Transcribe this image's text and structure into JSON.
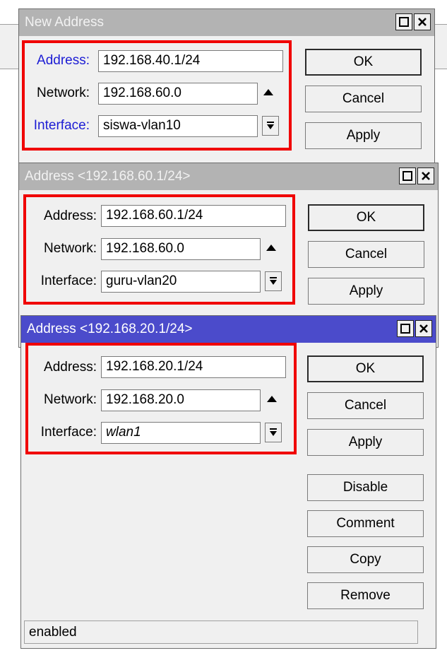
{
  "windows": [
    {
      "title": "New Address",
      "fields": {
        "address": {
          "label": "Address:",
          "value": "192.168.40.1/24"
        },
        "network": {
          "label": "Network:",
          "value": "192.168.60.0"
        },
        "interface": {
          "label": "Interface:",
          "value": "siswa-vlan10"
        }
      },
      "buttons": {
        "ok": "OK",
        "cancel": "Cancel",
        "apply": "Apply"
      }
    },
    {
      "title": "Address <192.168.60.1/24>",
      "fields": {
        "address": {
          "label": "Address:",
          "value": "192.168.60.1/24"
        },
        "network": {
          "label": "Network:",
          "value": "192.168.60.0"
        },
        "interface": {
          "label": "Interface:",
          "value": "guru-vlan20"
        }
      },
      "buttons": {
        "ok": "OK",
        "cancel": "Cancel",
        "apply": "Apply"
      }
    },
    {
      "title": "Address <192.168.20.1/24>",
      "fields": {
        "address": {
          "label": "Address:",
          "value": "192.168.20.1/24"
        },
        "network": {
          "label": "Network:",
          "value": "192.168.20.0"
        },
        "interface": {
          "label": "Interface:",
          "value": "wlan1"
        }
      },
      "buttons": {
        "ok": "OK",
        "cancel": "Cancel",
        "apply": "Apply",
        "disable": "Disable",
        "comment": "Comment",
        "copy": "Copy",
        "remove": "Remove"
      },
      "status": "enabled"
    }
  ],
  "colors": {
    "active_title": "#4b4bcb",
    "inactive_title": "#b3b3b3",
    "highlight_box": "#f00000",
    "link_label": "#1c1cd4"
  }
}
